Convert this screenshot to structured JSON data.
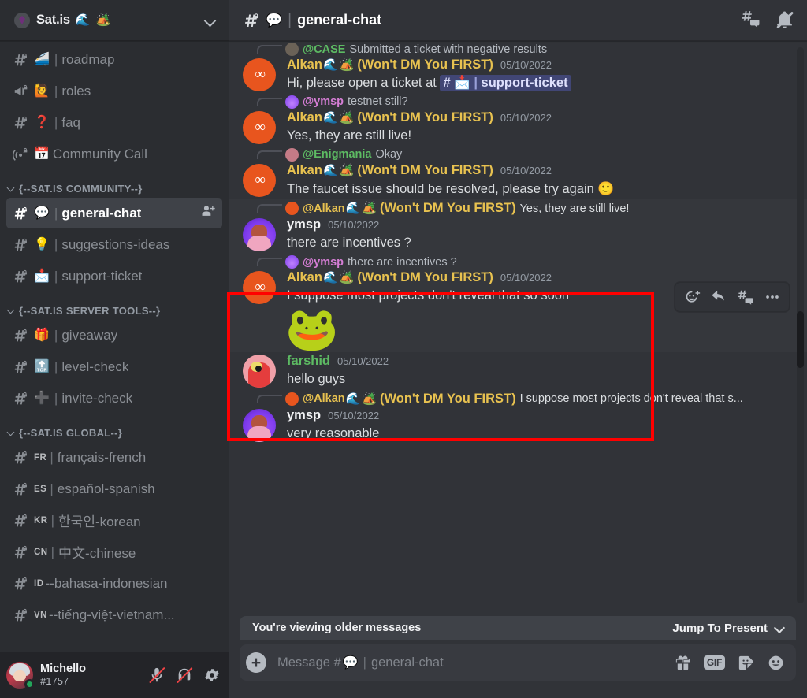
{
  "sidebar": {
    "server": {
      "name": "Sat.is",
      "emojis": [
        "🌊",
        "🏕️"
      ],
      "logo_icon": "server-logo-gem",
      "chevron_icon": "chevron-down-icon"
    },
    "groups": [
      {
        "label": null,
        "channels": [
          {
            "icon": "hash-lock-icon",
            "emoji": "🚄",
            "name": "roadmap",
            "active": false
          },
          {
            "icon": "announcement-lock-icon",
            "emoji": "🙋",
            "name": "roles",
            "active": false
          },
          {
            "icon": "hash-lock-icon",
            "emoji": "❓",
            "name": "faq",
            "active": false
          },
          {
            "icon": "stage-lock-icon",
            "emoji": "📅",
            "name": "Community Call",
            "active": false,
            "no_pipe": true
          }
        ]
      },
      {
        "label": "{--SAT.IS COMMUNITY--}",
        "channels": [
          {
            "icon": "hash-lock-icon",
            "emoji": "💬",
            "name": "general-chat",
            "active": true,
            "trailing_icon": "invite-member-icon"
          },
          {
            "icon": "hash-lock-icon",
            "emoji": "💡",
            "name": "suggestions-ideas",
            "active": false
          },
          {
            "icon": "hash-lock-icon",
            "emoji": "📩",
            "name": "support-ticket",
            "active": false
          }
        ]
      },
      {
        "label": "{--SAT.IS SERVER TOOLS--}",
        "channels": [
          {
            "icon": "hash-lock-icon",
            "emoji": "🎁",
            "name": "giveaway",
            "active": false
          },
          {
            "icon": "hash-lock-icon",
            "emoji": "🔝",
            "name": "level-check",
            "active": false
          },
          {
            "icon": "hash-lock-icon",
            "emoji": "➕",
            "name": "invite-check",
            "active": false
          }
        ]
      },
      {
        "label": "{--SAT.IS GLOBAL--}",
        "channels": [
          {
            "icon": "hash-lock-icon",
            "cc": "FR",
            "name": "français-french",
            "active": false
          },
          {
            "icon": "hash-lock-icon",
            "cc": "ES",
            "name": "español-spanish",
            "active": false
          },
          {
            "icon": "hash-lock-icon",
            "cc": "KR",
            "name": "한국인-korean",
            "active": false
          },
          {
            "icon": "hash-lock-icon",
            "cc": "CN",
            "name": "中文-chinese",
            "active": false
          },
          {
            "icon": "hash-lock-icon",
            "cc": "ID",
            "name": "--bahasa-indonesian",
            "active": false,
            "no_pipe": true
          },
          {
            "icon": "hash-lock-icon",
            "cc": "VN",
            "name": "--tiếng-việt-vietnam...",
            "active": false,
            "no_pipe": true
          }
        ]
      }
    ],
    "user_panel": {
      "name": "Michello",
      "tag": "#1757",
      "status": "online",
      "mute_icon": "microphone-muted-icon",
      "deafen_icon": "headphones-deafened-icon",
      "settings_icon": "gear-icon"
    }
  },
  "header": {
    "hash_icon": "hash-lock-icon",
    "emoji": "💬",
    "pipe": "|",
    "title": "general-chat",
    "threads_icon": "threads-icon",
    "notifications_icon": "bell-muted-icon"
  },
  "messages": [
    {
      "id": "m1",
      "reply": {
        "avatar": "case",
        "mention": "@CASE",
        "mention_color": "green",
        "text": "Submitted a ticket with negative results"
      },
      "avatar": "alkan",
      "author": "Alkan",
      "author_color": "gold",
      "badges": [
        "🌊",
        "🏕️"
      ],
      "suffix": "(Won't DM You FIRST)",
      "timestamp": "05/10/2022",
      "content_prefix": "Hi, please open a ticket at ",
      "channel_chip": {
        "hash": "#",
        "emoji": "📩",
        "pipe": "|",
        "name": "support-ticket"
      },
      "highlight": false
    },
    {
      "id": "m2",
      "reply": {
        "avatar": "ymsp",
        "mention": "@ymsp",
        "mention_color": "pink",
        "text": "testnet still?"
      },
      "avatar": "alkan",
      "author": "Alkan",
      "author_color": "gold",
      "badges": [
        "🌊",
        "🏕️"
      ],
      "suffix": "(Won't DM You FIRST)",
      "timestamp": "05/10/2022",
      "content": "Yes, they are still live!",
      "highlight": false
    },
    {
      "id": "m3",
      "reply": {
        "avatar": "enig",
        "mention": "@Enigmania",
        "mention_color": "green",
        "text": "Okay"
      },
      "avatar": "alkan",
      "author": "Alkan",
      "author_color": "gold",
      "badges": [
        "🌊",
        "🏕️"
      ],
      "suffix": "(Won't DM You FIRST)",
      "timestamp": "05/10/2022",
      "content": "The faucet issue should be resolved, please try again ",
      "trailing_emoji": "🙂",
      "highlight": false
    },
    {
      "id": "m4",
      "reply": {
        "avatar": "alkan",
        "mention": "@Alkan",
        "mention_color": "gold",
        "badges": [
          "🌊",
          "🏕️"
        ],
        "suffix": "(Won't DM You FIRST)",
        "text": "Yes, they are still live!",
        "text_white": true
      },
      "avatar": "ymsp",
      "author": "ymsp",
      "author_color": "white",
      "timestamp": "05/10/2022",
      "content": "there are incentives ?",
      "highlight": true
    },
    {
      "id": "m5",
      "reply": {
        "avatar": "ymsp",
        "mention": "@ymsp",
        "mention_color": "pink",
        "text": "there are incentives ?"
      },
      "avatar": "alkan",
      "author": "Alkan",
      "author_color": "gold",
      "badges": [
        "🌊",
        "🏕️"
      ],
      "suffix": "(Won't DM You FIRST)",
      "timestamp": "05/10/2022",
      "content": "I suppose most projects don't reveal that so soon",
      "highlight": true,
      "sticker": "🐸"
    },
    {
      "id": "m6",
      "avatar": "farshid",
      "author": "farshid",
      "author_color": "green",
      "timestamp": "05/10/2022",
      "content": "hello guys",
      "highlight": false
    },
    {
      "id": "m7",
      "reply": {
        "avatar": "alkan",
        "mention": "@Alkan",
        "mention_color": "gold",
        "badges": [
          "🌊",
          "🏕️"
        ],
        "suffix": "(Won't DM You FIRST)",
        "text": "I suppose most projects don't reveal that s...",
        "text_white": true
      },
      "avatar": "ymsp",
      "author": "ymsp",
      "author_color": "white",
      "timestamp": "05/10/2022",
      "content": "very reasonable",
      "highlight": false
    }
  ],
  "hover_toolbar": {
    "add_reaction_icon": "add-reaction-icon",
    "reply_icon": "reply-arrow-icon",
    "thread_icon": "create-thread-icon",
    "more_icon": "more-options-icon"
  },
  "jump_bar": {
    "message": "You're viewing older messages",
    "action_label": "Jump To Present",
    "chevron_icon": "chevron-down-icon"
  },
  "composer": {
    "add_icon": "plus-circle-icon",
    "placeholder_prefix": "Message #",
    "placeholder_emoji": "💬",
    "placeholder_pipe": "|",
    "placeholder_channel": "general-chat",
    "gift_icon": "gift-icon",
    "gif_label": "GIF",
    "sticker_icon": "sticker-icon",
    "emoji_icon": "emoji-smiley-icon"
  },
  "colors": {
    "sidebar_bg": "#2b2d31",
    "main_bg": "#313338",
    "highlight_border": "#ff0000",
    "highlight_bg": "#35373c",
    "author_gold": "#e8c250",
    "mention_green": "#5dbb63",
    "mention_pink": "#d57ed5",
    "online_green": "#23a55a",
    "mute_red": "#ed4245",
    "alkan_avatar": "#e8551e"
  }
}
